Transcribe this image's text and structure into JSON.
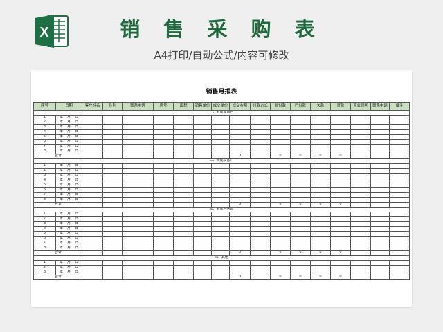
{
  "banner": {
    "title": "销 售 采 购 表",
    "subtitle": "A4打印/自动公式/内容可修改",
    "logo_letter": "X",
    "logo_icon": "excel-icon"
  },
  "colors": {
    "brand_green": "#1f6b3e",
    "header_fill": "#c9dfc0",
    "logo_green": "#1d7044"
  },
  "sheet": {
    "title": "销售月报表",
    "headers": [
      "序号",
      "日期",
      "客户姓名",
      "性别",
      "联系电话",
      "房号",
      "面积",
      "销售单价",
      "成交单价",
      "成交金额",
      "付款方式",
      "首付款",
      "已付款",
      "欠款",
      "贷款",
      "置业顾问",
      "联系电话",
      "备注"
    ],
    "date_parts": [
      "年",
      "月",
      "日"
    ],
    "total_label": "合计",
    "total_values": [
      "0",
      "0",
      "0",
      "0",
      "0"
    ],
    "sections": [
      {
        "title": "一、老成交客户",
        "rows": [
          "1",
          "2",
          "3",
          "4",
          "5",
          "6",
          "7",
          "8"
        ]
      },
      {
        "title": "二、新成交客户",
        "rows": [
          "1",
          "2",
          "3",
          "4",
          "5",
          "6",
          "7",
          "8"
        ]
      },
      {
        "title": "三、老客户回款",
        "rows": [
          "1",
          "2",
          "3",
          "4",
          "5",
          "6",
          "7",
          "8"
        ]
      },
      {
        "title": "四、其他",
        "rows": [
          "1",
          "2",
          "3"
        ]
      }
    ]
  }
}
